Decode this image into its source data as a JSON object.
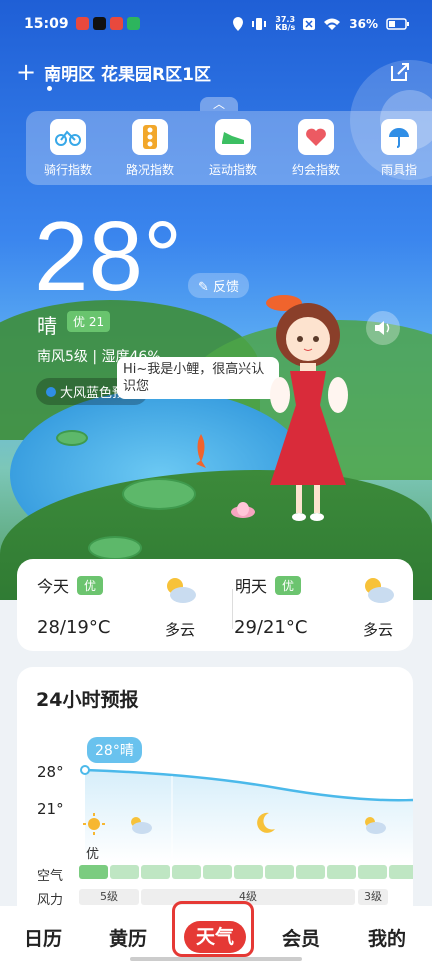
{
  "status_bar": {
    "time": "15:09",
    "network_speed": "37.3\nKB/s",
    "battery": "36%"
  },
  "location": {
    "name": "南明区 花果园R区1区"
  },
  "indices": [
    {
      "label": "骑行指数",
      "icon": "bike-icon"
    },
    {
      "label": "路况指数",
      "icon": "traffic-light-icon"
    },
    {
      "label": "运动指数",
      "icon": "sneaker-icon"
    },
    {
      "label": "约会指数",
      "icon": "heart-icon"
    },
    {
      "label": "雨具指",
      "icon": "umbrella-icon"
    }
  ],
  "current": {
    "temperature": "28°",
    "feedback": "反馈",
    "condition": "晴",
    "aqi": "优 21",
    "wind_humidity": "南风5级 | 湿度46%",
    "alert": "大风蓝色预警"
  },
  "mascot": {
    "speech": "Hi~我是小鲤，很高兴认识您"
  },
  "daily": {
    "today": {
      "label": "今天",
      "aqi": "优",
      "range": "28/19°C",
      "desc": "多云"
    },
    "tomorrow": {
      "label": "明天",
      "aqi": "优",
      "range": "29/21°C",
      "desc": "多云"
    }
  },
  "forecast_24h": {
    "title": "24小时预报",
    "current_label": "28°晴",
    "y_high": "28°",
    "y_low": "21°",
    "first_aqi": "优",
    "aqi_row_label": "空气",
    "wind_row_label": "风力",
    "wind": [
      "5级",
      "4级",
      "3级"
    ]
  },
  "nav": {
    "items": [
      "日历",
      "黄历",
      "天气",
      "会员",
      "我的"
    ],
    "active": "天气"
  }
}
